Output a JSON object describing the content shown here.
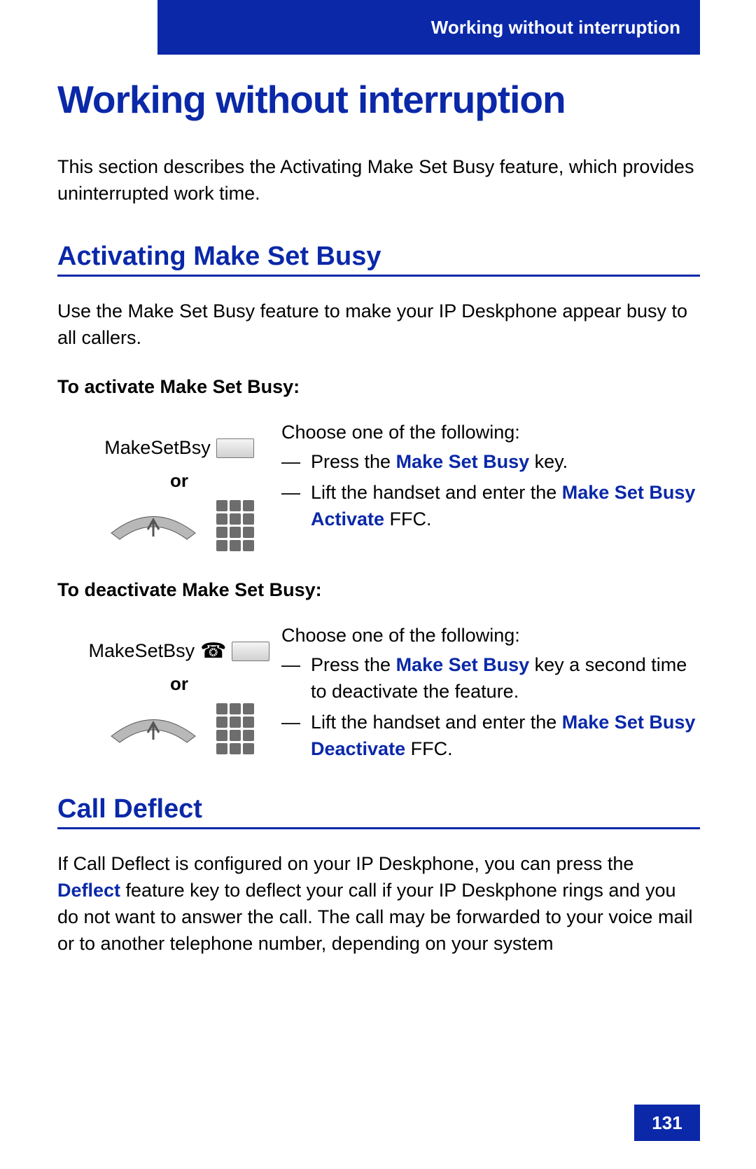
{
  "header": {
    "running_title": "Working without interruption"
  },
  "title": "Working without interruption",
  "intro": "This section describes the Activating Make Set Busy feature, which provides uninterrupted work time.",
  "section1": {
    "heading": "Activating Make Set Busy",
    "desc": "Use the Make Set Busy feature to make your IP Deskphone appear busy to all callers.",
    "activate_label": "To activate Make Set Busy:",
    "deactivate_label": "To deactivate Make Set Busy:",
    "softkey_label": "MakeSetBsy",
    "or": "or",
    "activate": {
      "lead": "Choose one of the following:",
      "item1_pre": "Press the ",
      "item1_kw": "Make Set Busy",
      "item1_post": " key.",
      "item2_pre": "Lift the handset and enter the ",
      "item2_kw": "Make Set Busy Activate",
      "item2_post": " FFC."
    },
    "deactivate": {
      "lead": "Choose one of the following:",
      "item1_pre": "Press the ",
      "item1_kw": "Make Set Busy",
      "item1_post": " key a second time to deactivate the feature.",
      "item2_pre": "Lift the handset and enter the ",
      "item2_kw": "Make Set Busy Deactivate",
      "item2_post": " FFC."
    }
  },
  "section2": {
    "heading": "Call Deflect",
    "desc_pre": "If Call Deflect is configured on your IP Deskphone, you can press the ",
    "desc_kw": "Deflect",
    "desc_post": " feature key to deflect your call if your IP Deskphone rings and you do not want to answer the call. The call may be forwarded to your voice mail or to another telephone number, depending on your system"
  },
  "page_number": "131"
}
